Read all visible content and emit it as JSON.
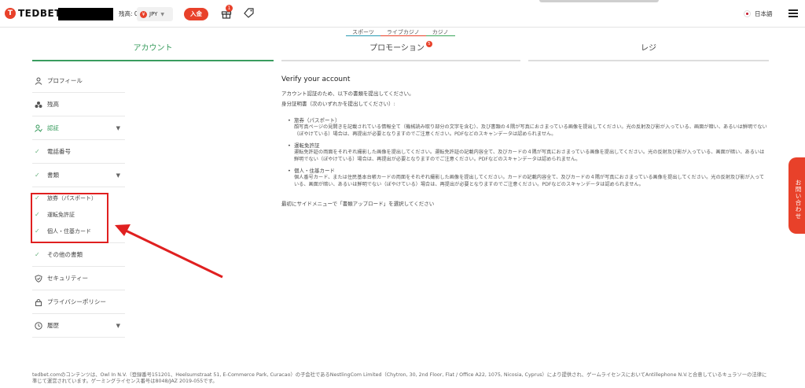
{
  "header": {
    "logo_mark": "T",
    "logo_text": "TEDBET",
    "balance_label": "残高: 0",
    "currency": "JPY",
    "currency_symbol": "¥",
    "deposit_label": "入金",
    "gift_badge": "1",
    "language": "日本語"
  },
  "subnav": [
    "スポーツ",
    "ライブカジノ",
    "カジノ"
  ],
  "tabs": [
    {
      "label": "アカウント"
    },
    {
      "label": "プロモーション",
      "badge": "5"
    },
    {
      "label": "レジ"
    }
  ],
  "sidebar": {
    "items": [
      {
        "label": "プロフィール",
        "icon": "user-icon"
      },
      {
        "label": "残高",
        "icon": "coins-icon"
      },
      {
        "label": "認証",
        "icon": "verify-icon"
      },
      {
        "label": "電話番号",
        "icon": "check-icon"
      },
      {
        "label": "書類",
        "icon": "check-icon"
      },
      {
        "label": "その他の書類",
        "icon": "check-icon"
      },
      {
        "label": "セキュリティー",
        "icon": "shield-icon"
      },
      {
        "label": "プライバシーポリシー",
        "icon": "lock-icon"
      },
      {
        "label": "履歴",
        "icon": "clock-icon"
      }
    ],
    "doc_subitems": [
      "旅券（パスポート）",
      "運転免許証",
      "個人・住基カード"
    ]
  },
  "main": {
    "title": "Verify your account",
    "intro": "アカウント認証のため、以下の書類を提出してください。",
    "req_label": "身分証明書（次のいずれかを提出してください）:",
    "docs": [
      {
        "title": "旅券（パスポート）",
        "desc": "顔写真ページの見開きを記載されている情報全て（機械読み取り部分の文字を含む）、及び書類の４隅が写真におさまっている画像を提出してください。光の反射及び影が入っている、画面が暗い、あるいは鮮明でない（ぼやけている）場合は、再提出が必要となりますのでご注意ください。PDFなどのスキャンデータは認められません。"
      },
      {
        "title": "運転免許証",
        "desc": "運転免許証の両面をそれぞれ撮影した画像を提出してください。運転免許証の記載内容全て、及びカードの４隅が写真におさまっている画像を提出してください。光の反射及び影が入っている、画面が暗い、あるいは鮮明でない（ぼやけている）場合は、再提出が必要となりますのでご注意ください。PDFなどのスキャンデータは認められません。"
      },
      {
        "title": "個人・住基カード",
        "desc": "個人番号カード、または住民基本台帳カードの両面をそれぞれ撮影した画像を提出してください。カードの記載内容全て、及びカードの４隅が写真におさまっている画像を提出してください。光の反射及び影が入っている、画面が暗い、あるいは鮮明でない（ぼやけている）場合は、再提出が必要となりますのでご注意ください。PDFなどのスキャンデータは認められません。"
      }
    ],
    "final_note": "最初にサイドメニューで「書類アップロード」を選択してください"
  },
  "contact_label": "お問い合わせ",
  "footer": "tedbet.comのコンテンツは、Owl In N.V.（登録番号151201、Heelsumstraat 51, E-Commerce Park, Curacao）の子会社であるNestlingCom Limited（Chytron, 30, 2nd Floor, Flat / Office A22, 1075, Nicosia, Cyprus）により提供され、ゲームライセンスにおいてAntillephone N.V.と合意しているキュラソーの法律に準じて運営されています。ゲーミングライセンス番号は8048/JAZ 2019-055です。",
  "colors": {
    "accent": "#e8412a",
    "green": "#3a9d5f",
    "annotation": "#e02020"
  }
}
